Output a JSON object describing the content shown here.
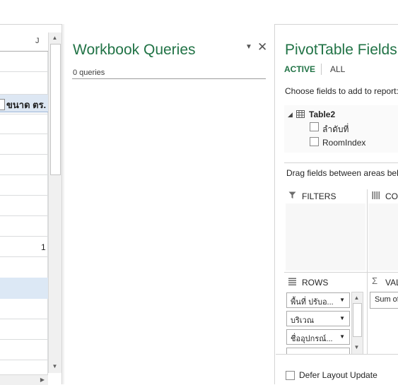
{
  "sheet": {
    "column_letter": "J",
    "header_cell": "ขนาด ตร.",
    "cell_value": "1"
  },
  "workbook_queries": {
    "title": "Workbook Queries",
    "count": "0 queries",
    "dropdown_icon": "caret-down-icon",
    "close_icon": "close-icon"
  },
  "pivot": {
    "title": "PivotTable Fields",
    "tabs": [
      "ACTIVE",
      "ALL"
    ],
    "choose_text": "Choose fields to add to report:",
    "table_name": "Table2",
    "fields": [
      "ลำดับที่",
      "RoomIndex"
    ],
    "drag_text": "Drag fields between areas below:",
    "areas": {
      "filters": "FILTERS",
      "columns": "COLUMNS",
      "rows": "ROWS",
      "values": "VALUES"
    },
    "row_fields": [
      "พื้นที่ ปรับอ...",
      "บริเวณ",
      "ชื่ออุปกรณ์..."
    ],
    "value_fields": [
      "Sum of"
    ],
    "defer_label": "Defer Layout Update"
  },
  "colors": {
    "accent_green": "#217346",
    "table_header": "#dde7f3",
    "selected_row": "#dce8f5"
  }
}
